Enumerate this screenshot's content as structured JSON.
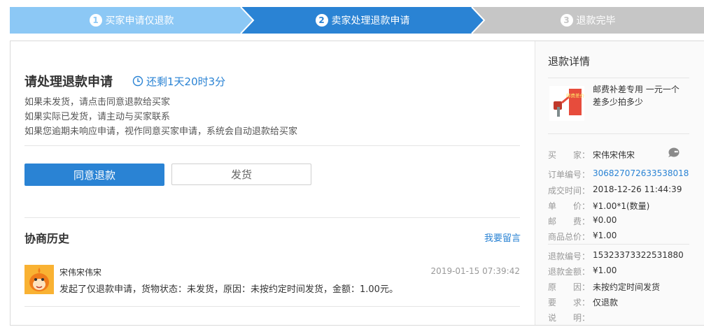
{
  "steps": [
    {
      "num": "1",
      "label": "买家申请仅退款",
      "state": "done",
      "color": "#8cc8f5"
    },
    {
      "num": "2",
      "label": "卖家处理退款申请",
      "state": "current",
      "color": "#2a83d4"
    },
    {
      "num": "3",
      "label": "退款完毕",
      "state": "todo",
      "color": "#c6c6c6"
    }
  ],
  "main": {
    "title": "请处理退款申请",
    "timer": "还剩1天20时3分",
    "notes": [
      "如果未发货，请点击同意退款给买家",
      "如果实际已发货，请主动与买家联系",
      "如果您逾期未响应申请，视作同意买家申请，系统会自动退款给买家"
    ],
    "agree_button": "同意退款",
    "ship_button": "发货"
  },
  "history": {
    "title": "协商历史",
    "leave_message": "我要留言",
    "items": [
      {
        "user": "宋伟宋伟宋",
        "time": "2019-01-15 07:39:42",
        "message": "发起了仅退款申请，货物状态：未发货，原因：未按约定时间发货，金额：1.00元。"
      }
    ]
  },
  "details": {
    "title": "退款详情",
    "product_name": "邮费补差专用 一元一个 差多少拍多少",
    "product_image_text": "邮费差价",
    "order_fields": [
      {
        "label": "买　　家：",
        "value": "宋伟宋伟宋"
      },
      {
        "label": "订单编号：",
        "value": "306827072633538018",
        "link": true
      },
      {
        "label": "成交时间：",
        "value": "2018-12-26 11:44:39"
      },
      {
        "label": "单　　价：",
        "value": "¥1.00*1(数量)"
      },
      {
        "label": "邮　　费：",
        "value": "¥0.00"
      },
      {
        "label": "商品总价：",
        "value": "¥1.00"
      }
    ],
    "refund_fields": [
      {
        "label": "退款编号：",
        "value": "15323373322531880"
      },
      {
        "label": "退款金额：",
        "value": "¥1.00"
      },
      {
        "label": "原　　因：",
        "value": "未按约定时间发货"
      },
      {
        "label": "要　　求：",
        "value": "仅退款"
      },
      {
        "label": "说　　明：",
        "value": ""
      }
    ]
  },
  "colors": {
    "accent": "#2a83d4",
    "step_done": "#8cc8f5",
    "step_todo": "#c6c6c6"
  }
}
